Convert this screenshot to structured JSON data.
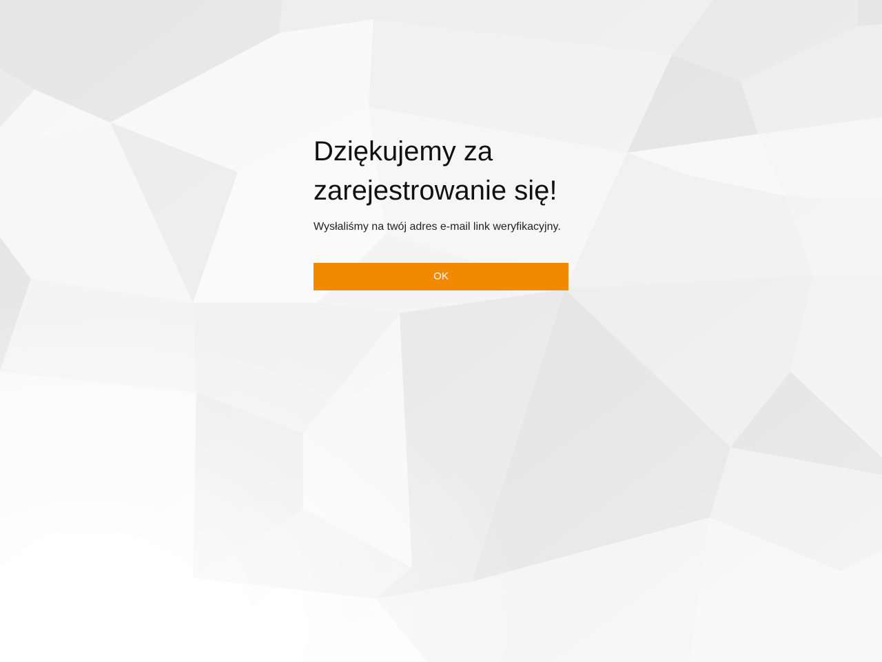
{
  "confirmation": {
    "title": "Dziękujemy za zarejestrowanie się!",
    "message": "Wysłaliśmy na twój adres e-mail link weryfikacyjny.",
    "ok_label": "OK"
  },
  "colors": {
    "accent": "#f28a00",
    "background": "#f2f2f2",
    "text": "#111111"
  }
}
